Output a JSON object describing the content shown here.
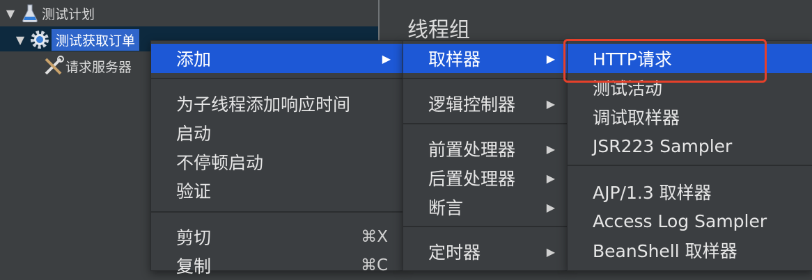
{
  "tree": {
    "test_plan": "测试计划",
    "thread_group": "测试获取订单",
    "http_defaults": "请求服务器"
  },
  "panel": {
    "title": "线程组"
  },
  "menu_main": {
    "add": "添加",
    "add_response_time": "为子线程添加响应时间",
    "start": "启动",
    "start_no_pause": "不停顿启动",
    "validate": "验证",
    "cut": "剪切",
    "cut_shortcut": "⌘X",
    "copy": "复制",
    "copy_shortcut": "⌘C"
  },
  "menu_add": {
    "sampler": "取样器",
    "logic_controller": "逻辑控制器",
    "pre_processor": "前置处理器",
    "post_processor": "后置处理器",
    "assertion": "断言",
    "timer": "定时器"
  },
  "menu_sampler": {
    "http_request": "HTTP请求",
    "test_action": "测试活动",
    "debug_sampler": "调试取样器",
    "jsr223": "JSR223 Sampler",
    "ajp": "AJP/1.3 取样器",
    "access_log": "Access Log Sampler",
    "beanshell": "BeanShell 取样器"
  },
  "colors": {
    "active": "#1d58d6",
    "highlight_box": "#e6402a"
  }
}
